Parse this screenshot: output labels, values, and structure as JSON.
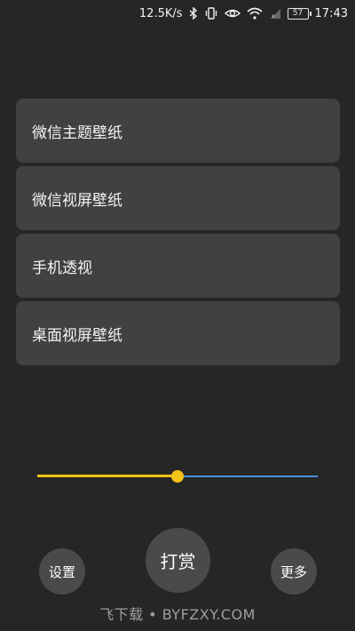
{
  "status_bar": {
    "net_speed": "12.5K/s",
    "battery_level": "57",
    "time": "17:43",
    "icons": [
      "bluetooth-icon",
      "vibrate-icon",
      "eye-icon",
      "wifi-icon",
      "no-signal-icon",
      "battery-icon"
    ]
  },
  "menu": {
    "items": [
      {
        "label": "微信主题壁纸"
      },
      {
        "label": "微信视屏壁纸"
      },
      {
        "label": "手机透视"
      },
      {
        "label": "桌面视屏壁纸"
      }
    ]
  },
  "slider": {
    "value_fraction": 0.5,
    "fill_color": "#f5c316",
    "track_color": "#4a90d9"
  },
  "buttons": {
    "settings_label": "设置",
    "tip_label": "打赏",
    "more_label": "更多"
  },
  "watermark": {
    "text": "飞下载 • BYFZXY.COM"
  },
  "colors": {
    "background": "#262626",
    "card": "#414141",
    "round_button": "#4a4a4a"
  }
}
